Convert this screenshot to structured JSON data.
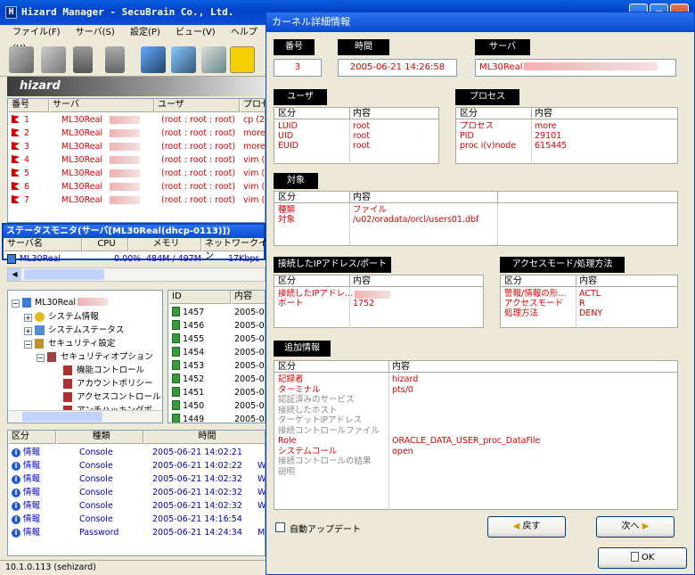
{
  "app": {
    "title": "Hizard Manager - SecuBrain Co., Ltd.",
    "logo": "hizard"
  },
  "menu": [
    "ファイル(F)",
    "サーバ(S)",
    "設定(P)",
    "ビュー(V)",
    "ヘルプ(H)"
  ],
  "alerts": {
    "headers": [
      "番号",
      "サーバ",
      "ユーザ",
      "プロセ"
    ],
    "rows": [
      {
        "no": "1",
        "server": "ML30Real",
        "user": "(root : root : root)",
        "proc": "cp (2"
      },
      {
        "no": "2",
        "server": "ML30Real",
        "user": "(root : root : root)",
        "proc": "more"
      },
      {
        "no": "3",
        "server": "ML30Real",
        "user": "(root : root : root)",
        "proc": "more"
      },
      {
        "no": "4",
        "server": "ML30Real",
        "user": "(root : root : root)",
        "proc": "vim ("
      },
      {
        "no": "5",
        "server": "ML30Real",
        "user": "(root : root : root)",
        "proc": "vim ("
      },
      {
        "no": "6",
        "server": "ML30Real",
        "user": "(root : root : root)",
        "proc": "vim ("
      },
      {
        "no": "7",
        "server": "ML30Real",
        "user": "(root : root : root)",
        "proc": "vim ("
      }
    ]
  },
  "status_monitor": {
    "title": "ステータスモニタ(サーバ[ML30Real(dhcp-0113)])",
    "headers": [
      "サーバ名",
      "CPU",
      "メモリ",
      "ネットワークイン"
    ],
    "row": {
      "server": "ML30Real",
      "cpu": "0.00%",
      "mem": "484M / 497M",
      "net": "17Kbps"
    }
  },
  "tree": {
    "root": "ML30Real",
    "items": [
      "システム情報",
      "システムステータス",
      "セキュリティ設定",
      "セキュリティオプション",
      "機能コントロール",
      "アカウントポリシー",
      "アクセスコントロール",
      "アンチハッキングポ"
    ]
  },
  "id_list": {
    "headers": [
      "ID",
      "内容"
    ],
    "rows": [
      {
        "id": "1457",
        "content": "2005-0"
      },
      {
        "id": "1456",
        "content": "2005-0"
      },
      {
        "id": "1455",
        "content": "2005-0"
      },
      {
        "id": "1454",
        "content": "2005-0"
      },
      {
        "id": "1453",
        "content": "2005-0"
      },
      {
        "id": "1452",
        "content": "2005-0"
      },
      {
        "id": "1451",
        "content": "2005-0"
      },
      {
        "id": "1450",
        "content": "2005-0"
      },
      {
        "id": "1449",
        "content": "2005-0"
      }
    ]
  },
  "log": {
    "headers": [
      "区分",
      "種類",
      "時間"
    ],
    "rows": [
      {
        "cat": "情報",
        "type": "Console",
        "time": "2005-06-21 14:02:21",
        "extra": ""
      },
      {
        "cat": "情報",
        "type": "Console",
        "time": "2005-06-21 14:02:22",
        "extra": "W"
      },
      {
        "cat": "情報",
        "type": "Console",
        "time": "2005-06-21 14:02:32",
        "extra": "W"
      },
      {
        "cat": "情報",
        "type": "Console",
        "time": "2005-06-21 14:02:32",
        "extra": "W"
      },
      {
        "cat": "情報",
        "type": "Console",
        "time": "2005-06-21 14:02:32",
        "extra": "W"
      },
      {
        "cat": "情報",
        "type": "Console",
        "time": "2005-06-21 14:16:54",
        "extra": ""
      },
      {
        "cat": "情報",
        "type": "Password",
        "time": "2005-06-21 14:24:34",
        "extra": "M"
      }
    ]
  },
  "statusbar": "10.1.0.113 (sehizard)",
  "dialog": {
    "title": "カーネル詳細情報",
    "num_label": "番号",
    "num": "3",
    "time_label": "時間",
    "time": "2005-06-21 14:26:58",
    "server_label": "サーバ",
    "server": "ML30Real",
    "kbn": "区分",
    "naiyo": "内容",
    "user": {
      "label": "ユーザ",
      "rows": [
        [
          "LUID",
          "root"
        ],
        [
          "UID",
          "root"
        ],
        [
          "EUID",
          "root"
        ]
      ]
    },
    "process": {
      "label": "プロセス",
      "rows": [
        [
          "プロセス",
          "more"
        ],
        [
          "PID",
          "29101"
        ],
        [
          "proc i(v)node",
          "615445"
        ]
      ]
    },
    "target": {
      "label": "対象",
      "rows": [
        [
          "種類",
          "ファイル"
        ],
        [
          "対象",
          "/u02/oradata/orcl/users01.dbf"
        ]
      ]
    },
    "ip": {
      "label": "接続したIPアドレス/ポート",
      "rows": [
        [
          "接続したIPアドレ...",
          ""
        ],
        [
          "ポート",
          "1752"
        ]
      ]
    },
    "access": {
      "label": "アクセスモード/処理方法",
      "rows": [
        [
          "警報/情報の形...",
          "ACTL"
        ],
        [
          "アクセスモード",
          "R"
        ],
        [
          "処理方法",
          "DENY"
        ]
      ]
    },
    "extra": {
      "label": "追加情報",
      "rows": [
        [
          "記録者",
          "hizard",
          "red"
        ],
        [
          "ターミナル",
          "pts/0",
          "red"
        ],
        [
          "認証済みのサービス",
          "",
          "gray"
        ],
        [
          "接続したホスト",
          "",
          "gray"
        ],
        [
          "ターゲットIPアドレス",
          "",
          "gray"
        ],
        [
          "接続コントロールファイル",
          "",
          "gray"
        ],
        [
          "Role",
          "ORACLE_DATA_USER_proc_DataFile",
          "red"
        ],
        [
          "システムコール",
          "open",
          "red"
        ],
        [
          "接続コントロールの結果",
          "",
          "gray"
        ],
        [
          "説明",
          "",
          "gray"
        ]
      ]
    },
    "auto_update": "自動アップデート",
    "back": "戻す",
    "next": "次へ",
    "ok": "OK"
  }
}
